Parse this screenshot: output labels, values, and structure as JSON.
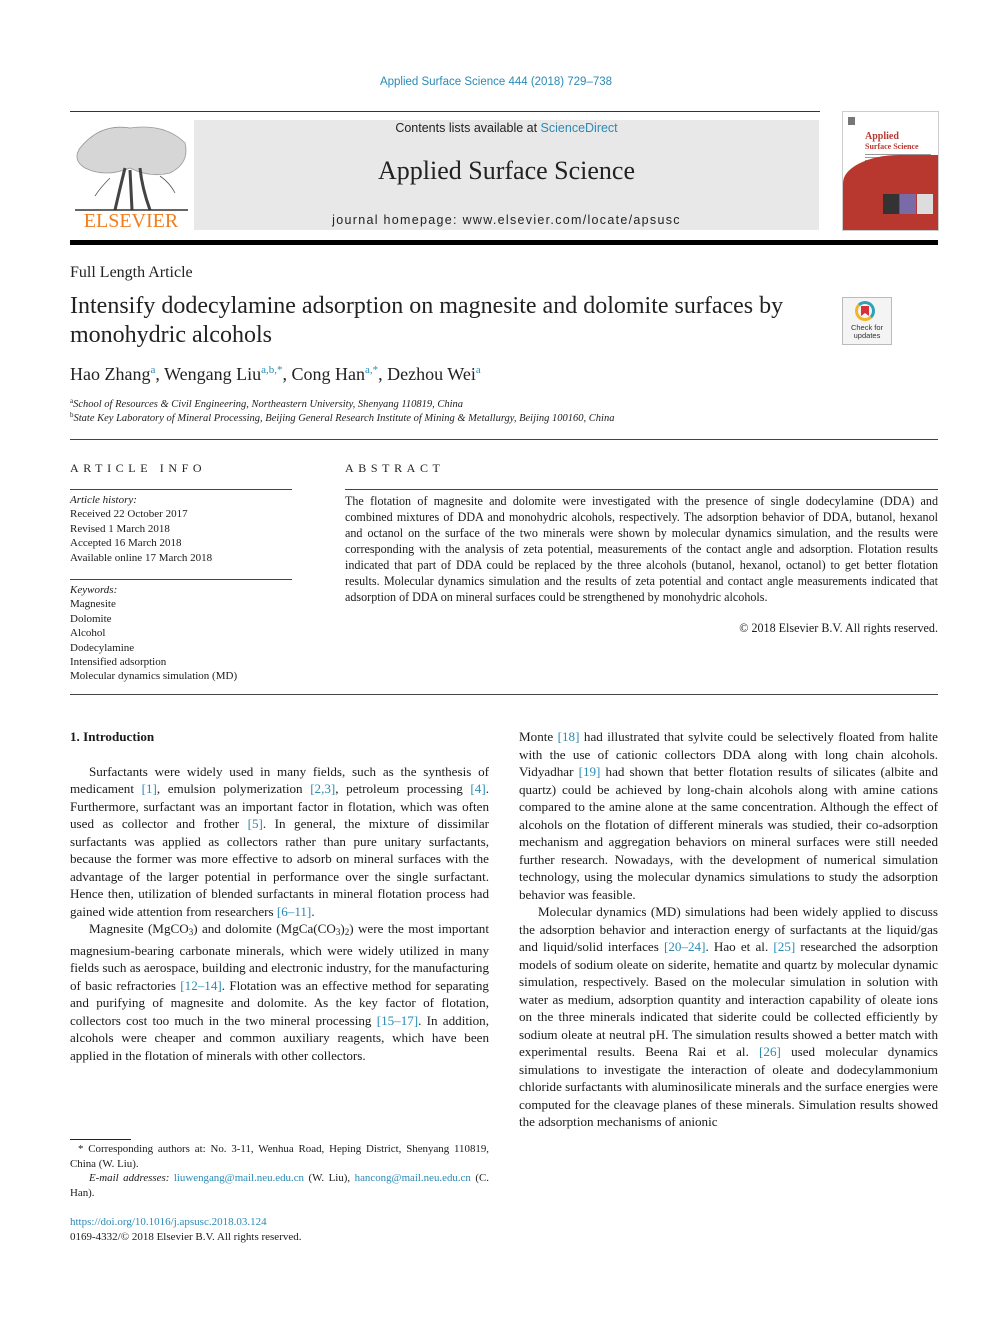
{
  "header": {
    "citation": "Applied Surface Science 444 (2018) 729–738",
    "contents_prefix": "Contents lists available at ",
    "contents_link": "ScienceDirect",
    "journal_name": "Applied Surface Science",
    "homepage": "journal homepage: www.elsevier.com/locate/apsusc",
    "publisher": "ELSEVIER",
    "cover_title_1": "Applied",
    "cover_title_2": "Surface Science",
    "crossmark_label_1": "Check for",
    "crossmark_label_2": "updates",
    "colors": {
      "link": "#2a8ab5",
      "elsevier_orange": "#f07e1e",
      "cover_red": "#b8372e",
      "masthead_bg": "#e8e8e8"
    }
  },
  "article": {
    "type": "Full Length Article",
    "title": "Intensify dodecylamine adsorption on magnesite and dolomite surfaces by monohydric alcohols",
    "authors": [
      {
        "name": "Hao Zhang",
        "sup": "a"
      },
      {
        "name": "Wengang Liu",
        "sup": "a,b,*"
      },
      {
        "name": "Cong Han",
        "sup": "a,*"
      },
      {
        "name": "Dezhou Wei",
        "sup": "a"
      }
    ],
    "affiliations": [
      {
        "key": "a",
        "text": "School of Resources & Civil Engineering, Northeastern University, Shenyang 110819, China"
      },
      {
        "key": "b",
        "text": "State Key Laboratory of Mineral Processing, Beijing General Research Institute of Mining & Metallurgy, Beijing 100160, China"
      }
    ]
  },
  "article_info": {
    "heading": "ARTICLE INFO",
    "history_label": "Article history:",
    "history": [
      "Received 22 October 2017",
      "Revised 1 March 2018",
      "Accepted 16 March 2018",
      "Available online 17 March 2018"
    ],
    "keywords_label": "Keywords:",
    "keywords": [
      "Magnesite",
      "Dolomite",
      "Alcohol",
      "Dodecylamine",
      "Intensified adsorption",
      "Molecular dynamics simulation (MD)"
    ]
  },
  "abstract": {
    "heading": "ABSTRACT",
    "text": "The flotation of magnesite and dolomite were investigated with the presence of single dodecylamine (DDA) and combined mixtures of DDA and monohydric alcohols, respectively. The adsorption behavior of DDA, butanol, hexanol and octanol on the surface of the two minerals were shown by molecular dynamics simulation, and the results were corresponding with the analysis of zeta potential, measurements of the contact angle and adsorption. Flotation results indicated that part of DDA could be replaced by the three alcohols (butanol, hexanol, octanol) to get better flotation results. Molecular dynamics simulation and the results of zeta potential and contact angle measurements indicated that adsorption of DDA on mineral surfaces could be strengthened by monohydric alcohols.",
    "copyright": "© 2018 Elsevier B.V. All rights reserved."
  },
  "body": {
    "section_heading": "1. Introduction",
    "p1": [
      "Surfactants were widely used in many fields, such as the synthesis of medicament ",
      {
        "ref": "[1]"
      },
      ", emulsion polymerization ",
      {
        "ref": "[2,3]"
      },
      ", petroleum processing ",
      {
        "ref": "[4]"
      },
      ". Furthermore, surfactant was an important factor in flotation, which was often used as collector and frother ",
      {
        "ref": "[5]"
      },
      ". In general, the mixture of dissimilar surfactants was applied as collectors rather than pure unitary surfactants, because the former was more effective to adsorb on mineral surfaces with the advantage of the larger potential in performance over the single surfactant. Hence then, utilization of blended surfactants in mineral flotation process had gained wide attention from researchers ",
      {
        "ref": "[6–11]"
      },
      "."
    ],
    "p2": [
      "Magnesite (MgCO",
      {
        "sub": "3"
      },
      ") and dolomite (MgCa(CO",
      {
        "sub": "3"
      },
      ")",
      {
        "sub": "2"
      },
      ") were the most important magnesium-bearing carbonate minerals, which were widely utilized in many fields such as aerospace, building and electronic industry, for the manufacturing of basic refractories ",
      {
        "ref": "[12–14]"
      },
      ". Flotation was an effective method for separating and purifying of magnesite and dolomite. As the key factor of flotation, collectors cost too much in the two mineral processing ",
      {
        "ref": "[15–17]"
      },
      ". In addition, alcohols were cheaper and common auxiliary reagents, which have been applied in the flotation of minerals with other collectors."
    ],
    "p3": [
      "Monte ",
      {
        "ref": "[18]"
      },
      " had illustrated that sylvite could be selectively floated from halite with the use of cationic collectors DDA along with long chain alcohols. Vidyadhar ",
      {
        "ref": "[19]"
      },
      " had shown that better flotation results of silicates (albite and quartz) could be achieved by long-chain alcohols along with amine cations compared to the amine alone at the same concentration. Although the effect of alcohols on the flotation of different minerals was studied, their co-adsorption mechanism and aggregation behaviors on mineral surfaces were still needed further research. Nowadays, with the development of numerical simulation technology, using the molecular dynamics simulations to study the adsorption behavior was feasible."
    ],
    "p4": [
      "Molecular dynamics (MD) simulations had been widely applied to discuss the adsorption behavior and interaction energy of surfactants at the liquid/gas and liquid/solid interfaces ",
      {
        "ref": "[20–24]"
      },
      ". Hao et al. ",
      {
        "ref": "[25]"
      },
      " researched the adsorption models of sodium oleate on siderite, hematite and quartz by molecular dynamic simulation, respectively. Based on the molecular simulation in solution with water as medium, adsorption quantity and interaction capability of oleate ions on the three minerals indicated that siderite could be collected efficiently by sodium oleate at neutral pH. The simulation results showed a better match with experimental results. Beena Rai et al. ",
      {
        "ref": "[26]"
      },
      " used molecular dynamics simulations to investigate the interaction of oleate and dodecylammonium chloride surfactants with aluminosilicate minerals and the surface energies were computed for the cleavage planes of these minerals. Simulation results showed the adsorption mechanisms of anionic"
    ]
  },
  "footer": {
    "corresponding": "* Corresponding authors at: No. 3-11, Wenhua Road, Heping District, Shenyang 110819, China (W. Liu).",
    "email_label": "E-mail addresses: ",
    "email_1": "liuwengang@mail.neu.edu.cn",
    "email_1_who": " (W. Liu), ",
    "email_2": "hancong@mail.neu.edu.cn",
    "email_2_who": " (C. Han).",
    "doi": "https://doi.org/10.1016/j.apsusc.2018.03.124",
    "issn": "0169-4332/© 2018 Elsevier B.V. All rights reserved."
  }
}
